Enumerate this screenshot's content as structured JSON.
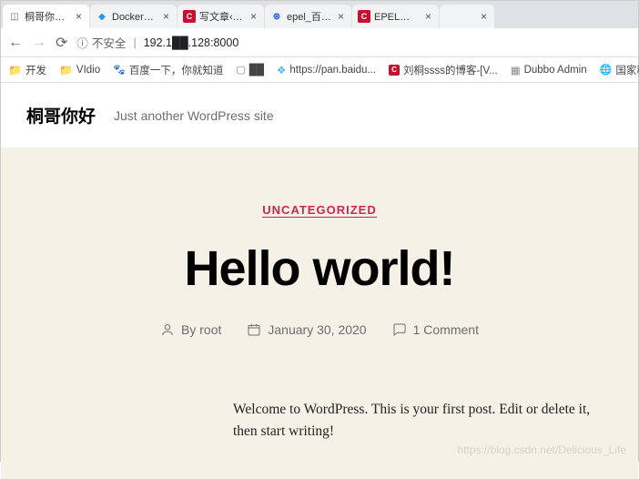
{
  "browser": {
    "tabs": [
      {
        "title": "桐哥你好 – Ju",
        "favicon": "wp",
        "active": true
      },
      {
        "title": "Docker常用命",
        "favicon": "docker",
        "active": false
      },
      {
        "title": "写文章‹CSDN",
        "favicon": "csdn",
        "active": false
      },
      {
        "title": "epel_百度搜索",
        "favicon": "baidu",
        "active": false
      },
      {
        "title": "EPEL源-是什么",
        "favicon": "csdn",
        "active": false
      },
      {
        "title": "",
        "favicon": "",
        "active": false
      }
    ],
    "nav": {
      "insecure_label": "不安全",
      "url": "192.1██.128:8000"
    },
    "bookmarks": [
      {
        "icon": "folder",
        "label": "开发"
      },
      {
        "icon": "folder",
        "label": "VIdio"
      },
      {
        "icon": "baidu-paw",
        "label": "百度一下，你就知道"
      },
      {
        "icon": "blank",
        "label": "██"
      },
      {
        "icon": "link",
        "label": "https://pan.baidu..."
      },
      {
        "icon": "csdn",
        "label": "刘桐ssss的博客-[V..."
      },
      {
        "icon": "dubbo",
        "label": "Dubbo Admin"
      },
      {
        "icon": "globe",
        "label": "国家税务总局河北..."
      }
    ]
  },
  "site": {
    "title": "桐哥你好",
    "tagline": "Just another WordPress site"
  },
  "post": {
    "category": "UNCATEGORIZED",
    "title": "Hello world!",
    "author_prefix": "By ",
    "author": "root",
    "date": "January 30, 2020",
    "comments": "1 Comment",
    "body": "Welcome to WordPress. This is your first post. Edit or delete it, then start writing!"
  },
  "watermark": "https://blog.csdn.net/Delicious_Life"
}
